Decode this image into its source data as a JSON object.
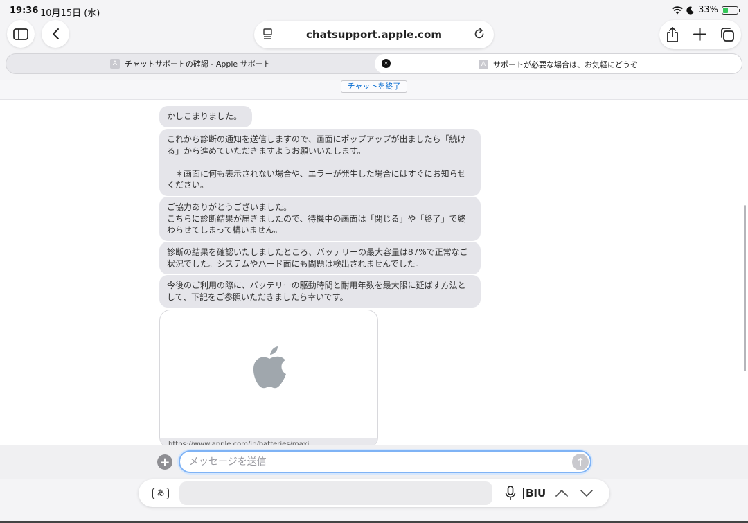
{
  "status": {
    "time": "19:36",
    "date": "10月15日 (水)",
    "battery": "33%",
    "battery_level": 0.33
  },
  "toolbar": {
    "url": "chatsupport.apple.com"
  },
  "tabs": [
    {
      "favicon": "A",
      "title": "チャットサポートの確認 - Apple サポート",
      "active": false
    },
    {
      "favicon": "A",
      "title": "サポートが必要な場合は、お気軽にどうぞ",
      "active": true
    }
  ],
  "chat": {
    "end_button": "チャットを終了",
    "messages": [
      "かしこまりました。",
      "これから診断の通知を送信しますので、画面にポップアップが出ましたら「続ける」から進めていただきますようお願いいたします。\n\n　＊画面に何も表示されない場合や、エラーが発生した場合にはすぐにお知らせください。",
      "ご協力ありがとうございました。\nこちらに診断結果が届きましたので、待機中の画面は「閉じる」や「終了」で終わらせてしまって構いません。",
      "診断の結果を確認いたしましたところ、バッテリーの最大容量は87%で正常なご状況でした。システムやハード面にも問題は検出されませんでした。",
      "今後のご利用の際に、バッテリーの駆動時間と耐用年数を最大限に延ばす方法として、下記をご参照いただきましたら幸いです。"
    ],
    "link_preview": "https://www.apple.com/jp/batteries/maxi..."
  },
  "input": {
    "placeholder": "メッセージを送信"
  },
  "keyboard": {
    "kana_key": "あ",
    "format": "BIU"
  },
  "colors": {
    "accent": "#0a6ed1",
    "bubble": "#e5e5ea",
    "focus_ring": "#7fb3f5"
  }
}
